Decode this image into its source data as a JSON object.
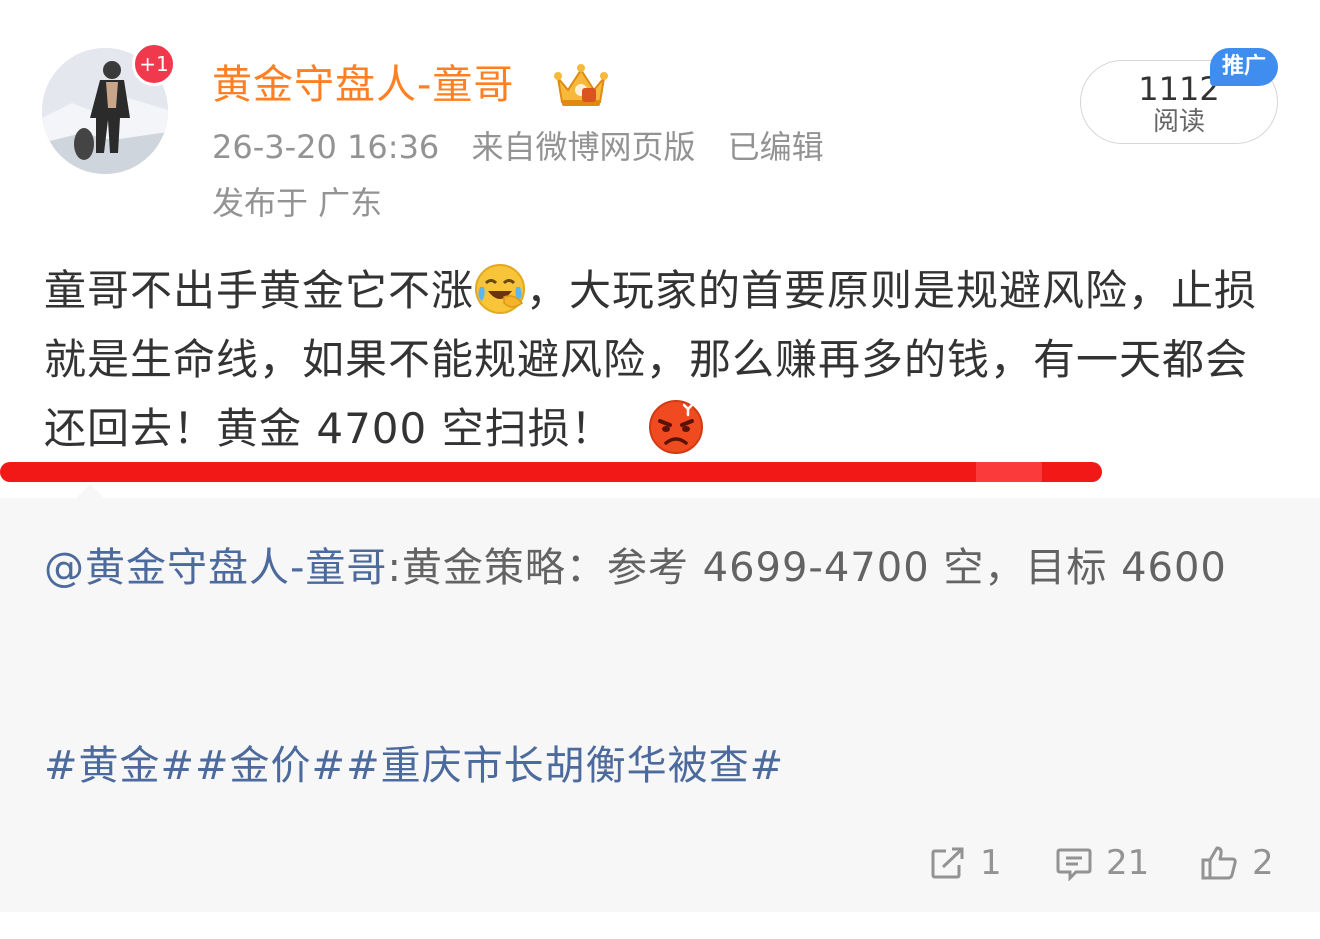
{
  "user": {
    "name": "黄金守盘人-童哥",
    "plus_badge": "+1",
    "crown_icon": "vip-crown-icon"
  },
  "meta": {
    "time": "26-3-20 16:36",
    "source": "来自微博网页版",
    "edited": "已编辑",
    "location": "发布于 广东"
  },
  "read": {
    "count": "1112",
    "label": "阅读",
    "promo": "推广"
  },
  "post": {
    "text_part1": "童哥不出手黄金它不涨",
    "text_part2": "，大玩家的首要原则是规避风险，止损就是生命线，如果不能规避风险，那么赚再多的钱，有一天都会还回去！黄金 4700 空扫损！",
    "emoji1": "laugh-cry-emoji",
    "emoji2": "angry-emoji"
  },
  "repost": {
    "mention": "@黄金守盘人-童哥",
    "text": ":黄金策略：参考 4699-4700 空，目标 4600",
    "hashtags": [
      "#黄金#",
      "#金价#",
      "#重庆市长胡衡华被查#"
    ]
  },
  "actions": {
    "share_count": "1",
    "comment_count": "21",
    "like_count": "2"
  },
  "colors": {
    "username": "#ff7f22",
    "link": "#4d6a9c",
    "meta": "#939393",
    "highlight_line": "#f21818",
    "promo": "#3f8eef"
  }
}
